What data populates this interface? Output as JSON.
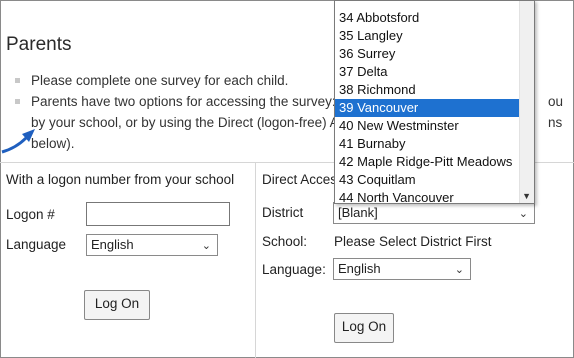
{
  "title": "Parents",
  "bullets": [
    "Please complete one survey for each child.",
    "Parents have two options for accessing the survey: e",
    "by your school, or by using the Direct (logon-free) A",
    "below)."
  ],
  "bullet2_right_fragment": "ou",
  "bullet3_right_fragment": "ns",
  "left_panel": {
    "heading": "With a logon number from your school",
    "logon_label": "Logon #",
    "logon_value": "",
    "language_label": "Language",
    "language_value": "English",
    "button_label": "Log On"
  },
  "right_panel": {
    "heading": "Direct Access",
    "district_label": "District",
    "district_value": "[Blank]",
    "school_label": "School:",
    "school_value": "Please Select District First",
    "language_label": "Language:",
    "language_value": "English",
    "button_label": "Log On"
  },
  "dropdown": {
    "items": [
      "34 Abbotsford",
      "35 Langley",
      "36 Surrey",
      "37 Delta",
      "38 Richmond",
      "39 Vancouver",
      "40 New Westminster",
      "41 Burnaby",
      "42 Maple Ridge-Pitt Meadows",
      "43 Coquitlam",
      "44 North Vancouver"
    ],
    "selected_index": 5
  },
  "colors": {
    "selection": "#1e71d0",
    "arrow": "#1f5fbf"
  },
  "icons": [
    "chevron-down-icon",
    "arrow-icon",
    "bullet-square-icon"
  ]
}
